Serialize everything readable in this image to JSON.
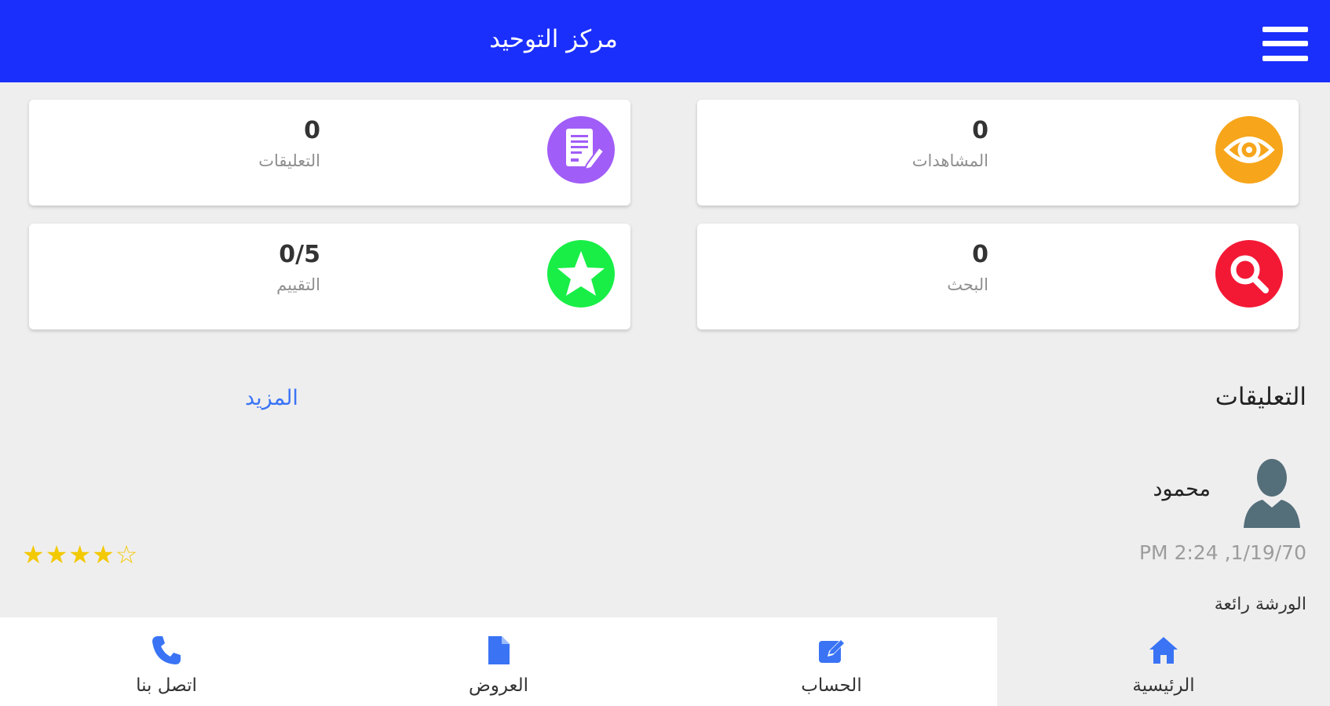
{
  "header": {
    "title": "مركز التوحيد",
    "menu_icon": "hamburger-menu-icon"
  },
  "stats": [
    {
      "value": "0",
      "label": "المشاهدات",
      "icon": "eye-icon",
      "color": "#f7a51b"
    },
    {
      "value": "0",
      "label": "التعليقات",
      "icon": "document-edit-icon",
      "color": "#a15df7"
    },
    {
      "value": "0",
      "label": "البحث",
      "icon": "search-icon",
      "color": "#f31935"
    },
    {
      "value": "0/5",
      "label": "التقييم",
      "icon": "star-icon",
      "color": "#19ee47"
    }
  ],
  "comments_section": {
    "title": "التعليقات",
    "more_label": "المزيد",
    "items": [
      {
        "author": "محمود",
        "date": "PM 2:24 ,1/19/70",
        "text": "الورشة رائعة",
        "stars": "★★★★☆",
        "rating": 4,
        "avatar_icon": "user-avatar-icon"
      }
    ]
  },
  "bottom_nav": [
    {
      "label": "الرئيسية",
      "icon": "home-icon",
      "active": true
    },
    {
      "label": "الحساب",
      "icon": "account-edit-icon",
      "active": false
    },
    {
      "label": "العروض",
      "icon": "file-icon",
      "active": false
    },
    {
      "label": "اتصل بنا",
      "icon": "phone-icon",
      "active": false
    }
  ],
  "colors": {
    "header": "#1a2ffc",
    "accent": "#3a74f5",
    "star": "#f3c900",
    "background": "#efeeee"
  }
}
